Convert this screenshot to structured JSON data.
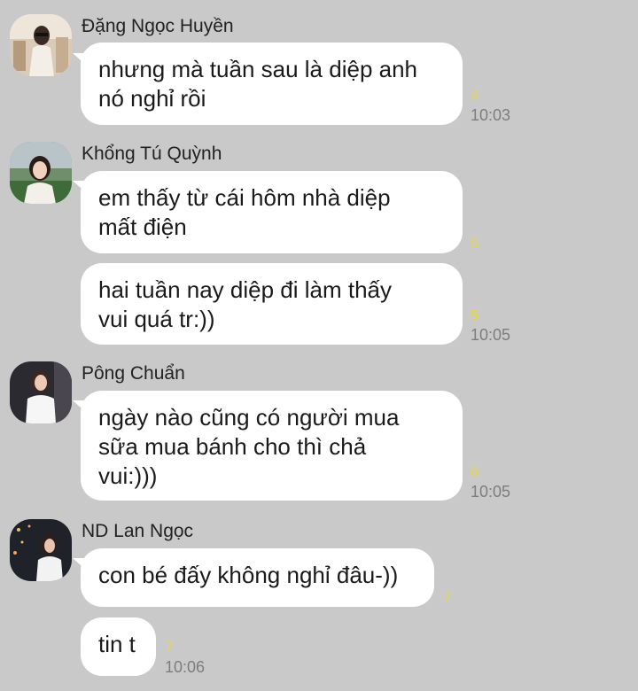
{
  "messages": [
    {
      "sender": "Đặng Ngọc Huyền",
      "bubbles": [
        {
          "lines": [
            "nhưng mà tuần sau là diệp anh",
            "nó nghỉ rồi"
          ],
          "unread": "4",
          "time": "10:03"
        }
      ]
    },
    {
      "sender": "Khổng Tú Quỳnh",
      "bubbles": [
        {
          "lines": [
            "em thấy từ cái hôm nhà diệp",
            "mất điện"
          ],
          "unread": "5",
          "time": ""
        },
        {
          "lines": [
            "hai tuần nay diệp đi làm thấy",
            "vui quá tr:))"
          ],
          "unread": "5",
          "time": "10:05"
        }
      ]
    },
    {
      "sender": "Pông Chuẩn",
      "bubbles": [
        {
          "lines": [
            "ngày nào cũng có người mua",
            "sữa mua bánh cho thì chả",
            "vui:)))"
          ],
          "unread": "6",
          "time": "10:05"
        }
      ]
    },
    {
      "sender": "ND Lan Ngọc",
      "bubbles": [
        {
          "lines": [
            "con bé đấy không nghỉ đâu-))"
          ],
          "unread": "7",
          "time": ""
        },
        {
          "lines": [
            "tin t"
          ],
          "unread": "7",
          "time": "10:06"
        }
      ]
    }
  ],
  "colors": {
    "background": "#c9c9c9",
    "bubble": "#ffffff",
    "unread": "#e7d64a",
    "time": "#7d7d7d"
  }
}
